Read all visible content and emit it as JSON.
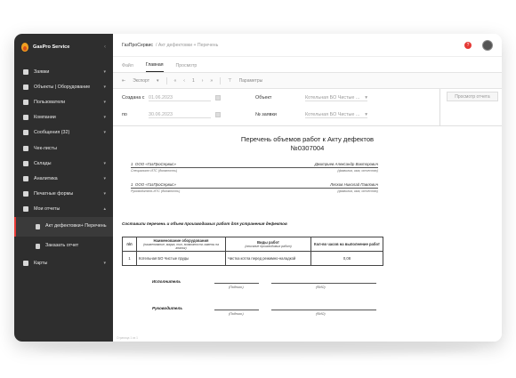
{
  "app": {
    "brand": "GasPro Service",
    "collapse_icon": "chevron-left"
  },
  "sidebar": {
    "items": [
      {
        "label": "Заявки",
        "icon": "requests-icon",
        "has_chevron": true
      },
      {
        "label": "Объекты | Оборудование",
        "icon": "wrench-icon",
        "has_chevron": true
      },
      {
        "label": "Пользователи",
        "icon": "users-icon",
        "has_chevron": true
      },
      {
        "label": "Компании",
        "icon": "briefcase-icon",
        "has_chevron": true
      },
      {
        "label": "Сообщения (32)",
        "icon": "chat-icon",
        "has_chevron": true
      },
      {
        "label": "Чек-листы",
        "icon": "checklist-icon",
        "has_chevron": false
      },
      {
        "label": "Склады",
        "icon": "warehouse-icon",
        "has_chevron": true
      },
      {
        "label": "Аналитика",
        "icon": "analytics-icon",
        "has_chevron": true
      },
      {
        "label": "Печатные формы",
        "icon": "print-icon",
        "has_chevron": true
      },
      {
        "label": "Мои отчеты",
        "icon": "reports-icon",
        "has_chevron": true,
        "expanded": true
      }
    ],
    "sub_items": [
      {
        "label": "Акт дефектовки+ Перечень",
        "icon": "document-icon",
        "active": true
      },
      {
        "label": "Заказать отчет",
        "icon": "document-icon",
        "active": false
      }
    ],
    "last_item": {
      "label": "Карты",
      "icon": "map-icon",
      "has_chevron": true
    }
  },
  "header": {
    "breadcrumb_main": "ГазПроСервис",
    "breadcrumb_rest": "/ Акт дефектовки + Перечень",
    "help_label": "?"
  },
  "tabs": [
    {
      "label": "Файл",
      "active": false
    },
    {
      "label": "Главная",
      "active": true
    },
    {
      "label": "Просмотр",
      "active": false
    }
  ],
  "toolbar": {
    "export_label": "Экспорт",
    "page_number": "1",
    "params_label": "Параметры"
  },
  "filters": {
    "created_from_label": "Создана с",
    "created_from_value": "01.06.2023",
    "to_label": "по",
    "to_value": "30.06.2023",
    "object_label": "Объект",
    "object_value": "Котельная БО Чистые ...",
    "request_label": "№ заявки",
    "request_value": "Котельная БО Чистые ...",
    "preview_button": "Просмотр отчета"
  },
  "document": {
    "title_line1": "Перечень объемов работ к Акту дефектов",
    "title_line2": "№0307004",
    "signatures": [
      {
        "num": "1",
        "org": "ООО «ГазПроСервис»",
        "name": "Дмитриев Александр Викторович",
        "cap_left": "Специалист ИТС (должность)",
        "cap_right": "(фамилия, имя, отчество)"
      },
      {
        "num": "1",
        "org": "ООО «ГазПроСервис»",
        "name": "Лесков Николай Павлович",
        "cap_left": "Руководитель ИТС (должность)",
        "cap_right": "(фамилия, имя, отчество)"
      }
    ],
    "section_title": "Составили перечень и объем производимых работ для устранения дефектов",
    "table": {
      "headers": [
        {
          "title": "п/п",
          "sub": ""
        },
        {
          "title": "Наименование оборудования",
          "sub": "(наименование, марка, тип, возможность замены на аналог)"
        },
        {
          "title": "Виды работ",
          "sub": "(описание производимых работ)"
        },
        {
          "title": "Кол-во часов на выполнение работ",
          "sub": ""
        }
      ],
      "rows": [
        {
          "num": "1",
          "equipment": "Котельная БО Чистые пруды",
          "work": "Чистка котла перед режимно-наладкой",
          "hours": "0,08"
        }
      ]
    },
    "executor_label": "Исполнитель",
    "manager_label": "Руководитель",
    "sign_caption": "(Подпись)",
    "fio_caption": "(ФИО)",
    "footer_note": "Страница 1 из 1"
  }
}
